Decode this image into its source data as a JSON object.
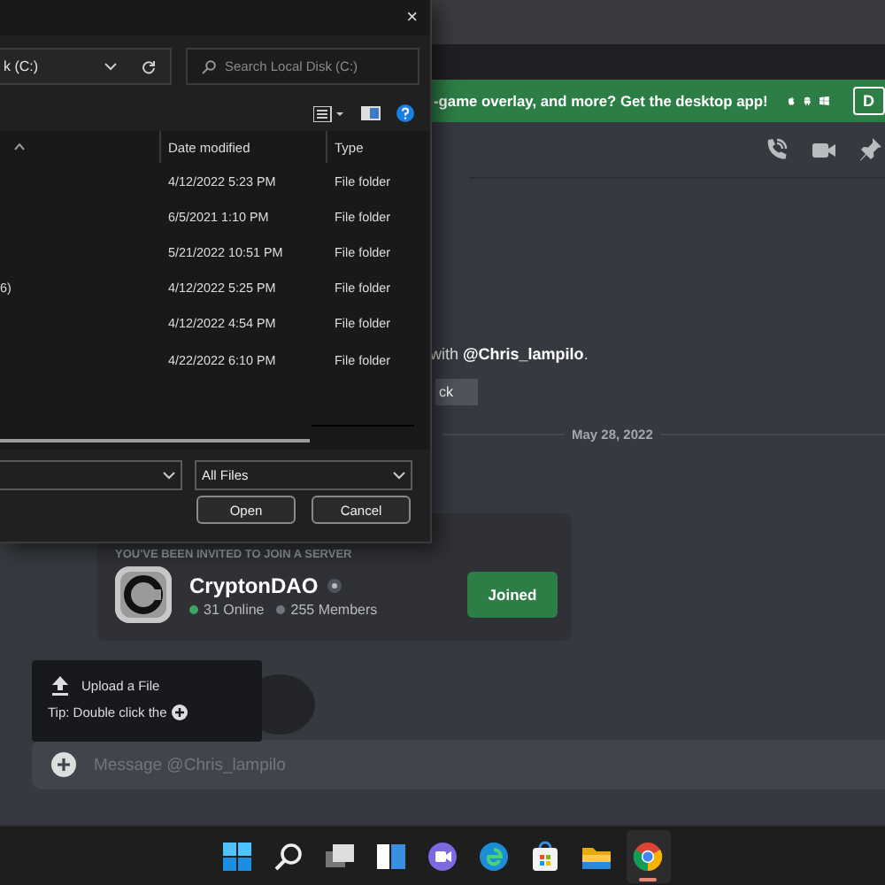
{
  "banner": {
    "text": "-game overlay, and more? Get the desktop app!",
    "button": "D"
  },
  "chat": {
    "mention_line": "with **@Chris_lampilo**.",
    "button_fragment": "ck",
    "date_divider": "May 28, 2022",
    "invite": {
      "heading": "YOU'VE BEEN INVITED TO JOIN A SERVER",
      "server_name": "CryptonDAO",
      "online": "31 Online",
      "members": "255 Members",
      "button": "Joined"
    }
  },
  "upload_menu": {
    "item": "Upload a File",
    "tip": "Tip: Double click the"
  },
  "message_input": {
    "placeholder": "Message @Chris_lampilo"
  },
  "file_dialog": {
    "close": "×",
    "address": "k (C:)",
    "search_placeholder": "Search Local Disk (C:)",
    "columns": [
      "Date modified",
      "Type"
    ],
    "rows": [
      {
        "name": "",
        "date": "4/12/2022 5:23 PM",
        "type": "File folder"
      },
      {
        "name": "",
        "date": "6/5/2021 1:10 PM",
        "type": "File folder"
      },
      {
        "name": "",
        "date": "5/21/2022 10:51 PM",
        "type": "File folder"
      },
      {
        "name": "6)",
        "date": "4/12/2022 5:25 PM",
        "type": "File folder"
      },
      {
        "name": "",
        "date": "4/12/2022 4:54 PM",
        "type": "File folder"
      },
      {
        "name": "",
        "date": "4/22/2022 6:10 PM",
        "type": "File folder"
      }
    ],
    "file_type": "All Files",
    "buttons": [
      "Open",
      "Cancel"
    ]
  },
  "taskbar": {
    "apps": [
      {
        "kind": "start",
        "active": false
      },
      {
        "kind": "search",
        "active": false
      },
      {
        "kind": "taskview",
        "active": false
      },
      {
        "kind": "widgets",
        "active": false
      },
      {
        "kind": "chat",
        "active": false
      },
      {
        "kind": "edge",
        "active": false
      },
      {
        "kind": "store",
        "active": false
      },
      {
        "kind": "explorer",
        "active": false
      },
      {
        "kind": "chrome",
        "active": true
      }
    ]
  }
}
